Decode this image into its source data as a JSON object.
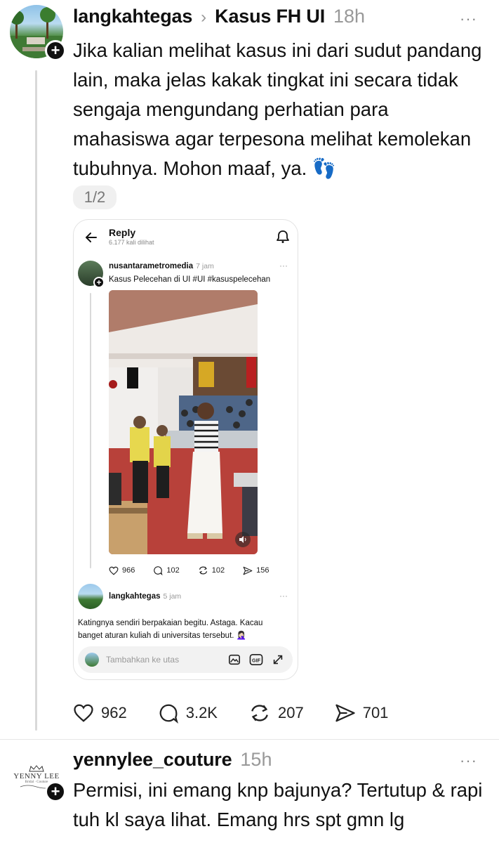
{
  "post1": {
    "username": "langkahtegas",
    "separator": "›",
    "topic": "Kasus FH UI",
    "time": "18h",
    "more": "···",
    "text": "Jika kalian melihat kasus ini dari sudut pandang lain, maka jelas kakak tingkat ini secara tidak sengaja mengundang perhatian para mahasiswa agar terpesona melihat kemolekan tubuhnya. Mohon maaf, ya. 👣",
    "pager": "1/2",
    "actions": {
      "likes": "962",
      "replies": "3.2K",
      "reposts": "207",
      "shares": "701"
    }
  },
  "embed": {
    "header_title": "Reply",
    "header_views": "6.177 kali dilihat",
    "post": {
      "username": "nusantarametromedia",
      "time": "7 jam",
      "more": "···",
      "caption": "Kasus Pelecehan di UI #UI #kasuspelecehan",
      "actions": {
        "likes": "966",
        "replies": "102",
        "reposts": "102",
        "shares": "156"
      }
    },
    "reply": {
      "username": "langkahtegas",
      "time": "5 jam",
      "more": "···",
      "text": "Katingnya sendiri berpakaian begitu. Astaga. Kacau banget aturan kuliah di universitas tersebut. 🤦🏻‍♀️"
    },
    "composer_placeholder": "Tambahkan ke utas"
  },
  "post2": {
    "username": "yennylee_couture",
    "time": "15h",
    "more": "···",
    "avatar_logo_top": "YENNY LEE",
    "avatar_logo_sub": "Bridal · Couture",
    "text": "Permisi, ini emang knp bajunya? Tertutup & rapi tuh kl saya lihat. Emang hrs spt gmn lg"
  },
  "colors": {
    "text": "#101010",
    "muted": "#999999",
    "line": "#d9d9d9",
    "border": "#e2e2e2"
  }
}
